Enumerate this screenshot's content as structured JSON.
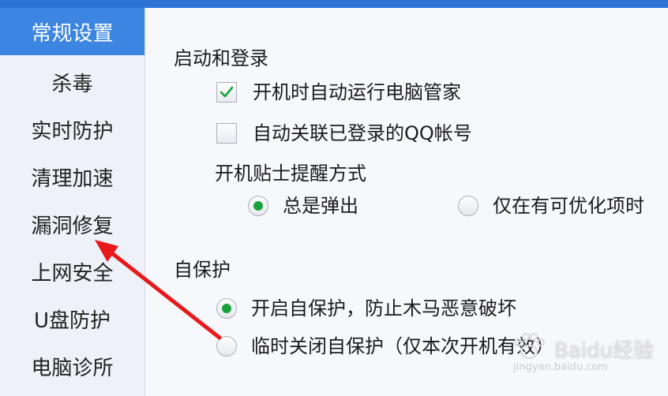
{
  "sidebar": {
    "items": [
      {
        "label": "常规设置",
        "active": true
      },
      {
        "label": "杀毒",
        "active": false
      },
      {
        "label": "实时防护",
        "active": false
      },
      {
        "label": "清理加速",
        "active": false
      },
      {
        "label": "漏洞修复",
        "active": false
      },
      {
        "label": "上网安全",
        "active": false
      },
      {
        "label": "U盘防护",
        "active": false
      },
      {
        "label": "电脑诊所",
        "active": false
      }
    ]
  },
  "startup": {
    "title": "启动和登录",
    "auto_run": {
      "label": "开机时自动运行电脑管家",
      "checked": true
    },
    "auto_link_qq": {
      "label": "自动关联已登录的QQ帐号",
      "checked": false
    },
    "tips_label": "开机贴士提醒方式",
    "tips_options": [
      {
        "label": "总是弹出",
        "selected": true
      },
      {
        "label": "仅在有可优化项时",
        "selected": false
      }
    ]
  },
  "self_protect": {
    "title": "自保护",
    "options": [
      {
        "label": "开启自保护，防止木马恶意破坏",
        "selected": true
      },
      {
        "label": "临时关闭自保护（仅本次开机有效）",
        "selected": false
      }
    ]
  },
  "watermark": {
    "main": "Baidu经验",
    "sub": "jingyan.baidu.com"
  },
  "colors": {
    "accent": "#3c85e0",
    "radio_selected": "#19a23a",
    "check": "#19a23a",
    "arrow": "#e8191b"
  },
  "icons": {
    "check": "check-icon",
    "arrow": "annotation-arrow"
  }
}
